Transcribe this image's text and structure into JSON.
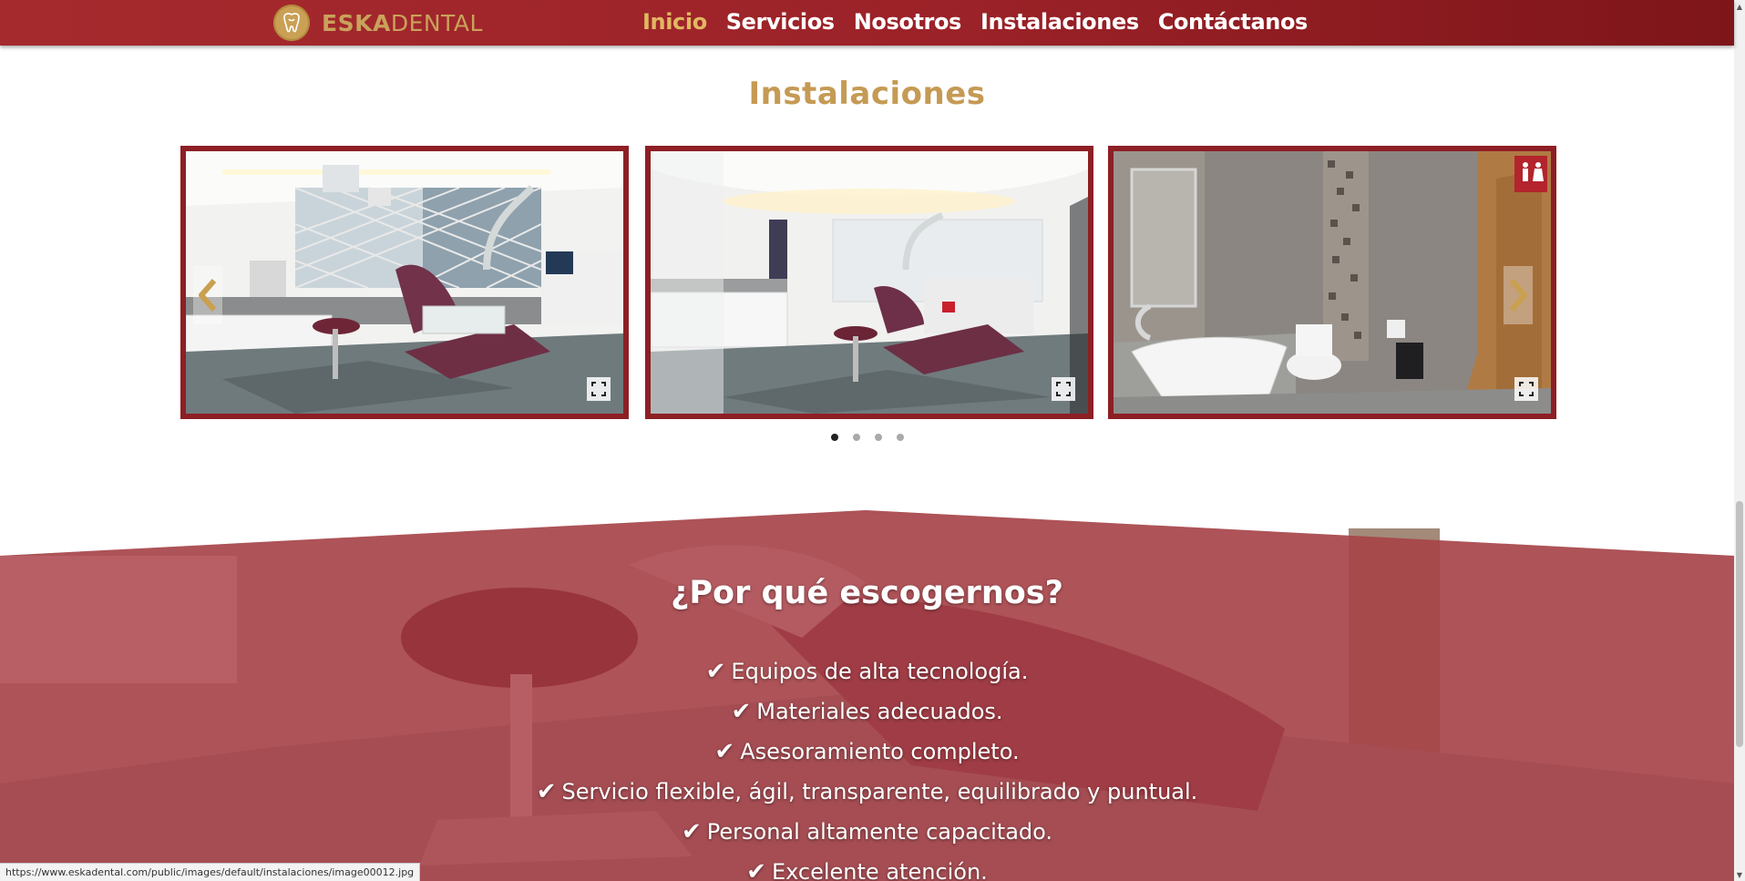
{
  "brand": {
    "name_bold": "ESKA",
    "name_light": "DENTAL"
  },
  "nav": {
    "items": [
      {
        "label": "Inicio",
        "active": true
      },
      {
        "label": "Servicios"
      },
      {
        "label": "Nosotros"
      },
      {
        "label": "Instalaciones"
      },
      {
        "label": "Contáctanos"
      }
    ]
  },
  "instalaciones": {
    "title": "Instalaciones",
    "slides": [
      {
        "icon": "expand-icon"
      },
      {
        "icon": "expand-icon"
      },
      {
        "icon": "expand-icon"
      }
    ],
    "prev_icon": "chevron-left-icon",
    "next_icon": "chevron-right-icon",
    "dots": 4,
    "active_dot": 1
  },
  "why": {
    "title": "¿Por qué escogernos?",
    "items": [
      "Equipos de alta tecnología.",
      "Materiales adecuados.",
      "Asesoramiento completo.",
      "Servicio flexible, ágil, transparente, equilibrado y puntual.",
      "Personal altamente capacitado.",
      "Excelente atención."
    ]
  },
  "status_url": "https://www.eskadental.com/public/images/default/instalaciones/image00012.jpg",
  "colors": {
    "brand_red": "#9b2228",
    "gold": "#c59a54",
    "overlay": "#a9323a"
  }
}
